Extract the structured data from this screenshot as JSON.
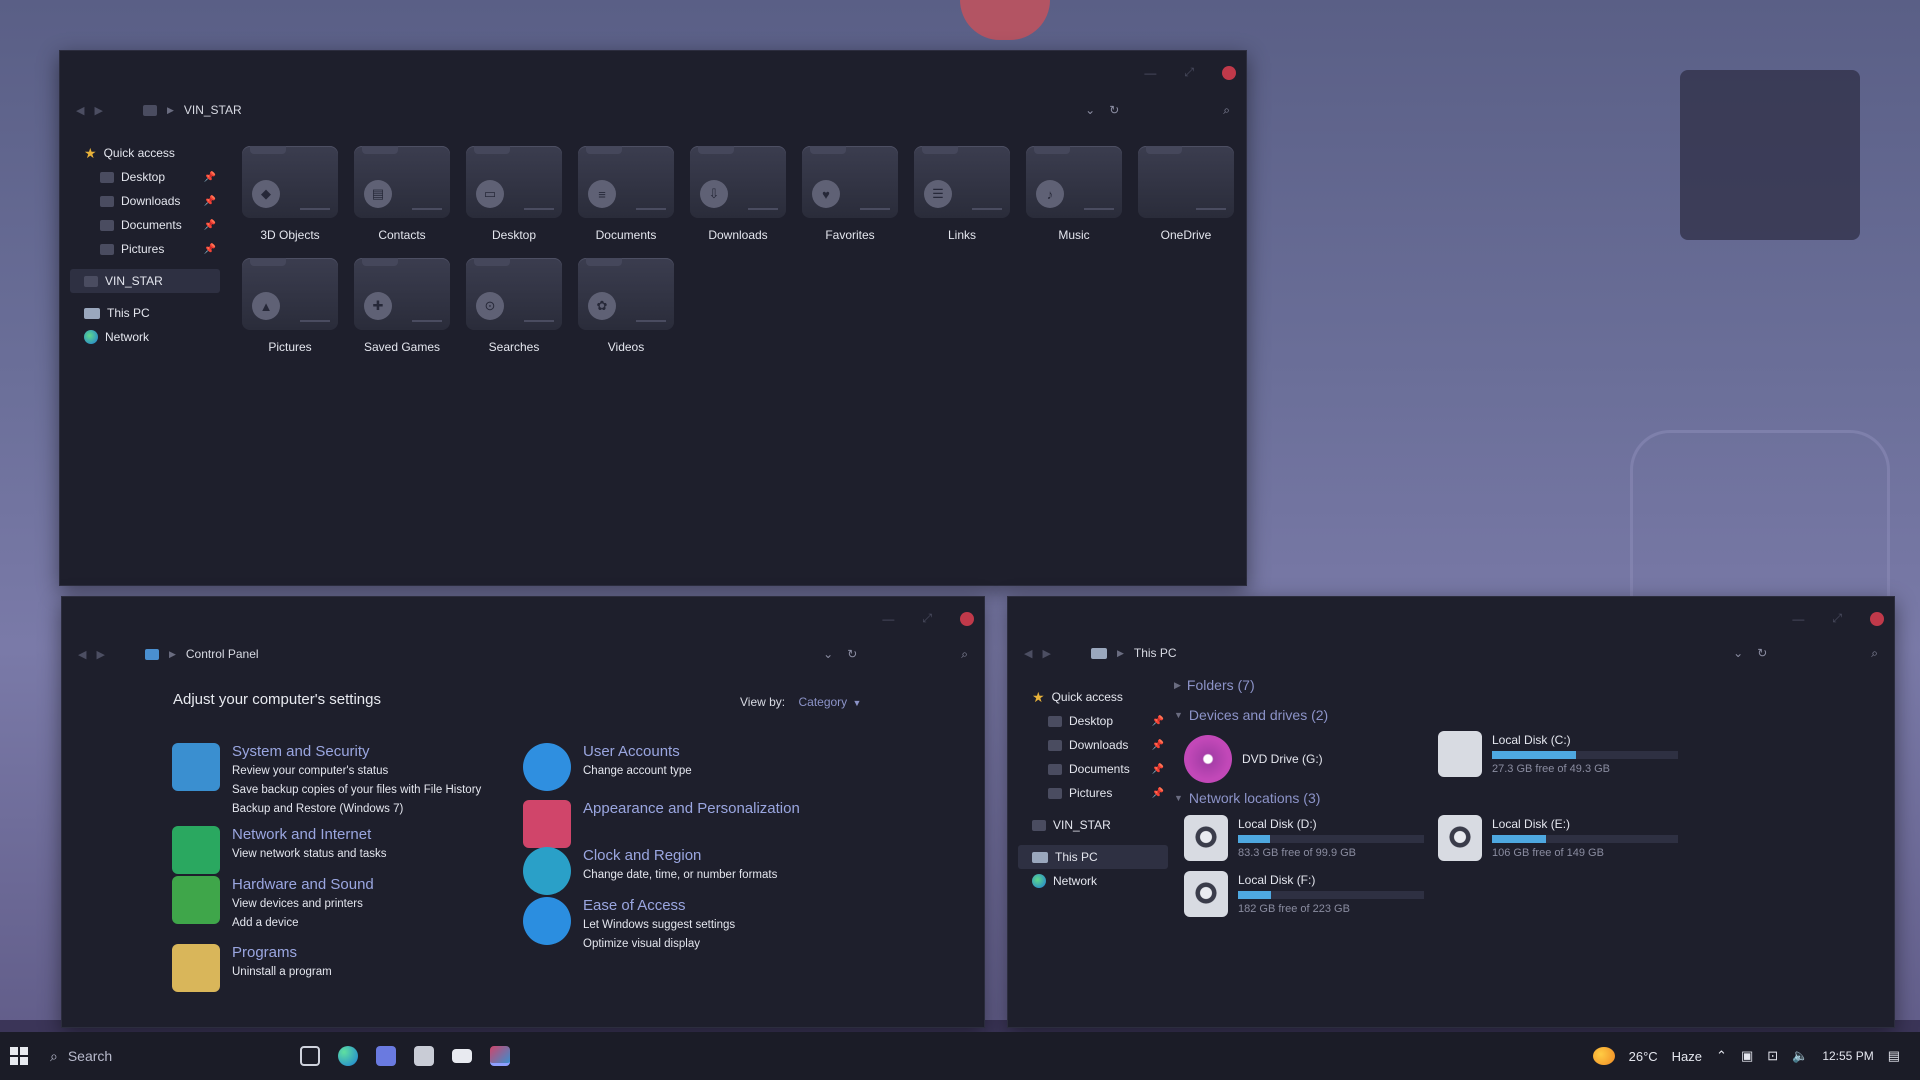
{
  "win1": {
    "path": "VIN_STAR",
    "sidebar": [
      {
        "label": "Quick access",
        "type": "star"
      },
      {
        "label": "Desktop",
        "type": "sub"
      },
      {
        "label": "Downloads",
        "type": "sub"
      },
      {
        "label": "Documents",
        "type": "sub"
      },
      {
        "label": "Pictures",
        "type": "sub"
      },
      {
        "label": "VIN_STAR",
        "type": "sel"
      },
      {
        "label": "This PC",
        "type": "pc"
      },
      {
        "label": "Network",
        "type": "net"
      }
    ],
    "folders": [
      {
        "label": "3D Objects",
        "icon": "cube-icon",
        "glyph": "◆"
      },
      {
        "label": "Contacts",
        "icon": "contacts-icon",
        "glyph": "▤"
      },
      {
        "label": "Desktop",
        "icon": "monitor-icon",
        "glyph": "▭"
      },
      {
        "label": "Documents",
        "icon": "document-icon",
        "glyph": "≡"
      },
      {
        "label": "Downloads",
        "icon": "download-icon",
        "glyph": "⇩"
      },
      {
        "label": "Favorites",
        "icon": "heart-icon",
        "glyph": "♥"
      },
      {
        "label": "Links",
        "icon": "link-icon",
        "glyph": "☰"
      },
      {
        "label": "Music",
        "icon": "music-icon",
        "glyph": "♪"
      },
      {
        "label": "OneDrive",
        "icon": "",
        "glyph": ""
      },
      {
        "label": "Pictures",
        "icon": "picture-icon",
        "glyph": "▲"
      },
      {
        "label": "Saved Games",
        "icon": "gamepad-icon",
        "glyph": "✚"
      },
      {
        "label": "Searches",
        "icon": "search-icon",
        "glyph": "⊙"
      },
      {
        "label": "Videos",
        "icon": "film-reel-icon",
        "glyph": "✿"
      }
    ]
  },
  "cp": {
    "path": "Control Panel",
    "heading": "Adjust your computer's settings",
    "view_by_label": "View by:",
    "view_by_value": "Category",
    "left": [
      {
        "title": "System and Security",
        "subs": [
          "Review your computer's status",
          "Save backup copies of your files with File History",
          "Backup and Restore (Windows 7)"
        ],
        "color": "#3a8fd0"
      },
      {
        "title": "Network and Internet",
        "subs": [
          "View network status and tasks"
        ],
        "color": "#2aa860"
      },
      {
        "title": "Hardware and Sound",
        "subs": [
          "View devices and printers",
          "Add a device"
        ],
        "color": "#3fa64a"
      },
      {
        "title": "Programs",
        "subs": [
          "Uninstall a program"
        ],
        "color": "#d9b65a"
      }
    ],
    "right": [
      {
        "title": "User Accounts",
        "subs": [
          "Change account type"
        ],
        "color": "#2f8fe0"
      },
      {
        "title": "Appearance and Personalization",
        "subs": [],
        "color": "#d0456a"
      },
      {
        "title": "Clock and Region",
        "subs": [
          "Change date, time, or number formats"
        ],
        "color": "#2aa0c8"
      },
      {
        "title": "Ease of Access",
        "subs": [
          "Let Windows suggest settings",
          "Optimize visual display"
        ],
        "color": "#2b8ee0"
      }
    ]
  },
  "pc": {
    "path": "This PC",
    "sidebar": [
      {
        "label": "Quick access",
        "type": "star"
      },
      {
        "label": "Desktop",
        "type": "sub"
      },
      {
        "label": "Downloads",
        "type": "sub"
      },
      {
        "label": "Documents",
        "type": "sub"
      },
      {
        "label": "Pictures",
        "type": "sub"
      },
      {
        "label": "VIN_STAR",
        "type": "plain"
      },
      {
        "label": "This PC",
        "type": "sel"
      },
      {
        "label": "Network",
        "type": "net"
      }
    ],
    "groups": {
      "folders": "Folders (7)",
      "devices": "Devices and drives (2)",
      "network": "Network locations (3)"
    },
    "dvd": "DVD Drive (G:)",
    "drives": [
      {
        "name": "Local Disk (C:)",
        "free": "27.3 GB free of 49.3 GB",
        "fill": 0.45
      },
      {
        "name": "Local Disk (D:)",
        "free": "83.3 GB free of 99.9 GB",
        "fill": 0.17
      },
      {
        "name": "Local Disk  (E:)",
        "free": "106 GB free of 149 GB",
        "fill": 0.29
      },
      {
        "name": "Local Disk (F:)",
        "free": "182 GB free of 223 GB",
        "fill": 0.18
      }
    ]
  },
  "taskbar": {
    "search": "Search",
    "weather": "26°C",
    "condition": "Haze",
    "time": "12:55 PM"
  }
}
